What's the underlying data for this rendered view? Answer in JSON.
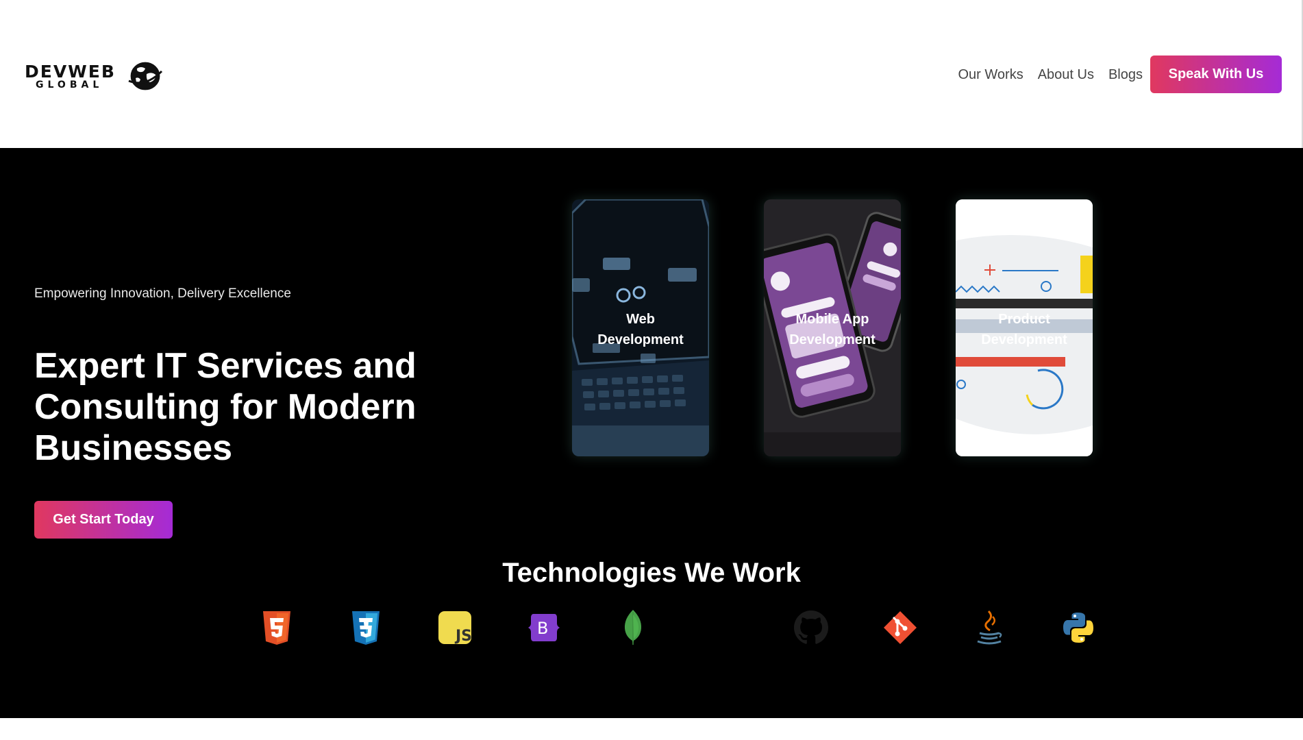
{
  "header": {
    "logo": {
      "word": "DEVWEB",
      "sub": "GLOBAL"
    },
    "nav": [
      {
        "label": "Our Works"
      },
      {
        "label": "About Us"
      },
      {
        "label": "Blogs"
      }
    ],
    "cta_label": "Speak With Us"
  },
  "hero": {
    "tagline": "Empowering Innovation, Delivery Excellence",
    "headline": "Expert IT Services and Consulting for Modern Businesses",
    "cta_label": "Get Start Today",
    "cards": [
      {
        "line1": "Web",
        "line2": "Development"
      },
      {
        "line1": "Mobile App",
        "line2": "Development"
      },
      {
        "line1": "Product",
        "line2": "Development"
      }
    ]
  },
  "technologies": {
    "title": "Technologies We Work",
    "icons": [
      "html5-icon",
      "css3-icon",
      "javascript-icon",
      "bootstrap-icon",
      "mongodb-icon",
      "github-icon",
      "git-icon",
      "java-icon",
      "python-icon"
    ]
  },
  "colors": {
    "accent_start": "#e0385f",
    "accent_end": "#a52bd6",
    "hero_bg": "#000000"
  }
}
